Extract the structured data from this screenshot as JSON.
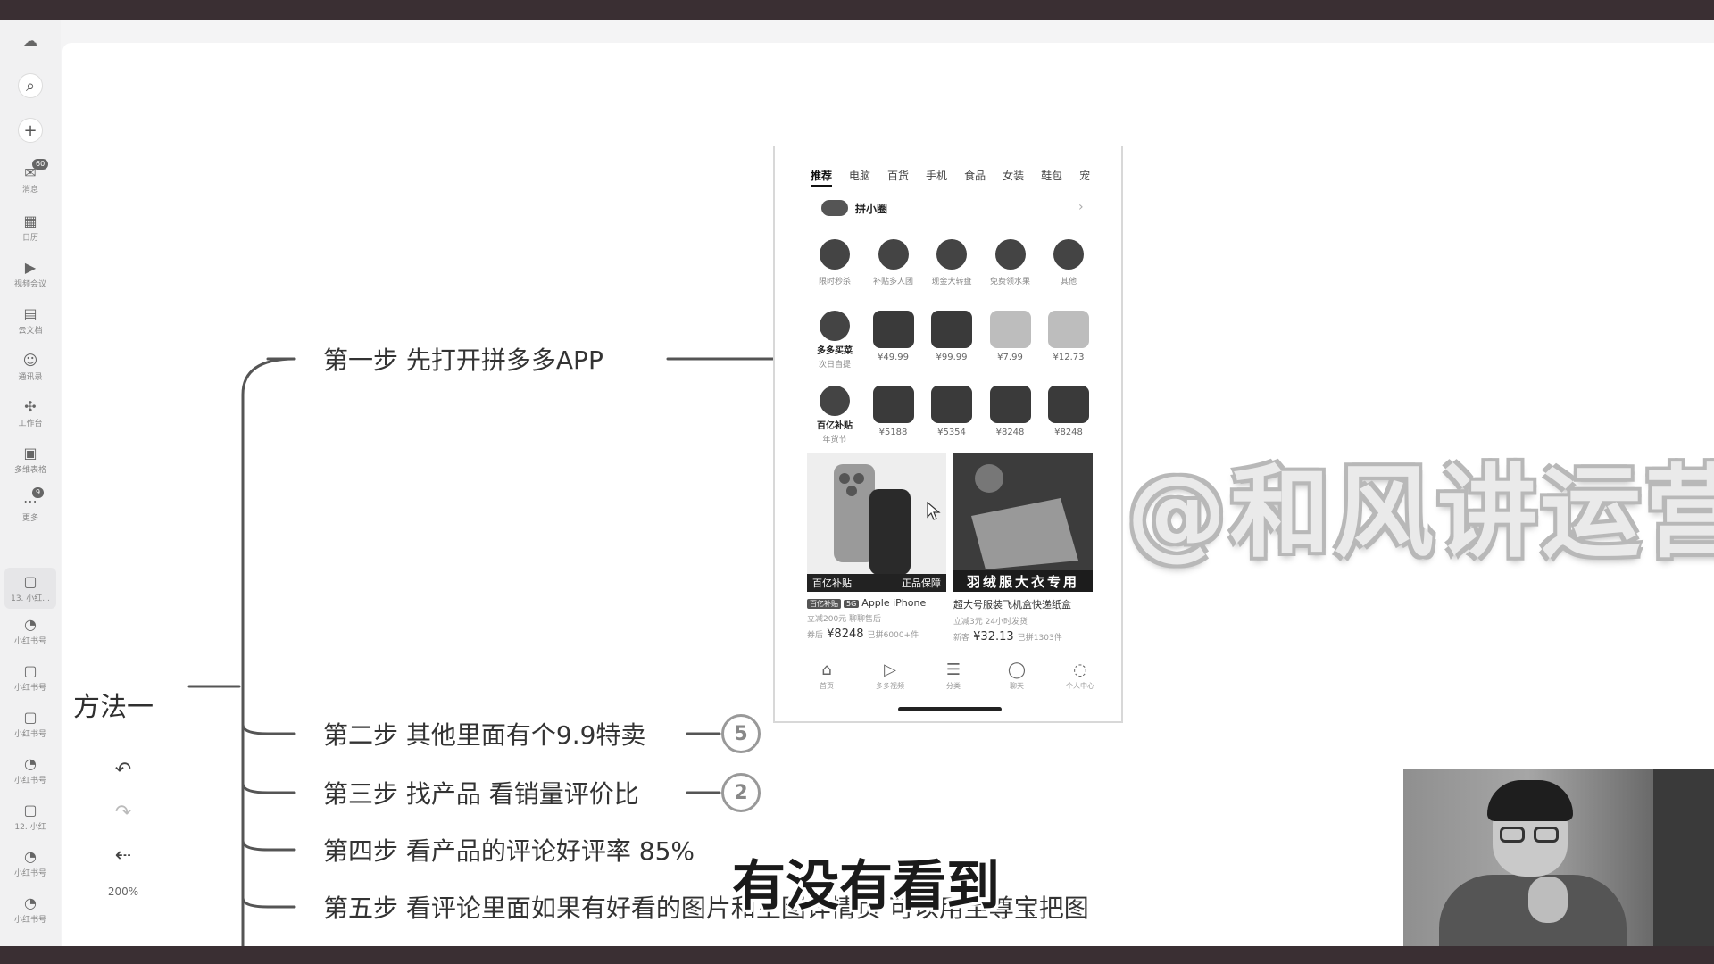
{
  "rail": {
    "message_label": "消息",
    "message_badge": "60",
    "calendar_label": "日历",
    "meeting_label": "视频会议",
    "docs_label": "云文档",
    "contacts_label": "通讯录",
    "workbench_label": "工作台",
    "multidim_label": "多维表格",
    "more_label": "更多",
    "more_badge": "9",
    "recent": [
      "13. 小红...",
      "小红书号",
      "小红书号",
      "小红书号",
      "小红书号",
      "12. 小红",
      "小红书号",
      "小红书号"
    ]
  },
  "mindmap": {
    "root": "方法一",
    "steps": [
      {
        "label": "第一步 先打开拼多多APP"
      },
      {
        "label": "第二步 其他里面有个9.9特卖",
        "count": "5"
      },
      {
        "label": "第三步 找产品 看销量评价比",
        "count": "2"
      },
      {
        "label": "第四步 看产品的评论好评率 85%"
      },
      {
        "label": "第五步 看评论里面如果有好看的图片和主图详情页 可以用至尊宝把图"
      }
    ]
  },
  "toolbar": {
    "zoom": "200%"
  },
  "phone": {
    "tabs": [
      "推荐",
      "电脑",
      "百货",
      "手机",
      "食品",
      "女装",
      "鞋包",
      "宠"
    ],
    "pin_label": "拼小圈",
    "row1": [
      "限时秒杀",
      "补贴多人团",
      "现金大转盘",
      "免费领水果",
      "其他"
    ],
    "row2_label": "多多买菜",
    "row2_sub": "次日自提",
    "row2_prices": [
      "¥49.99",
      "¥99.99",
      "¥7.99",
      "¥12.73"
    ],
    "row3_label": "百亿补贴",
    "row3_sub": "年货节",
    "row3_prices": [
      "¥5188",
      "¥5354",
      "¥8248",
      "¥8248"
    ],
    "card1": {
      "strip_left": "百亿补贴",
      "strip_right": "正品保障",
      "tag1": "百亿补贴",
      "tag2": "5G",
      "title": "Apple iPhone",
      "sub": "立减200元  聊聊售后",
      "price_prefix": "券后",
      "price": "¥8248",
      "sold": "已拼6000+件"
    },
    "card2": {
      "strip": "羽绒服大衣专用",
      "title": "超大号服装飞机盒快递纸盒",
      "sub": "立减3元  24小时发货",
      "price_prefix": "新客",
      "price": "¥32.13",
      "sold": "已拼1303件"
    },
    "nav": [
      "首页",
      "多多视频",
      "分类",
      "聊天",
      "个人中心"
    ]
  },
  "watermark": "@和风讲运营",
  "subtitle": "有没有看到"
}
